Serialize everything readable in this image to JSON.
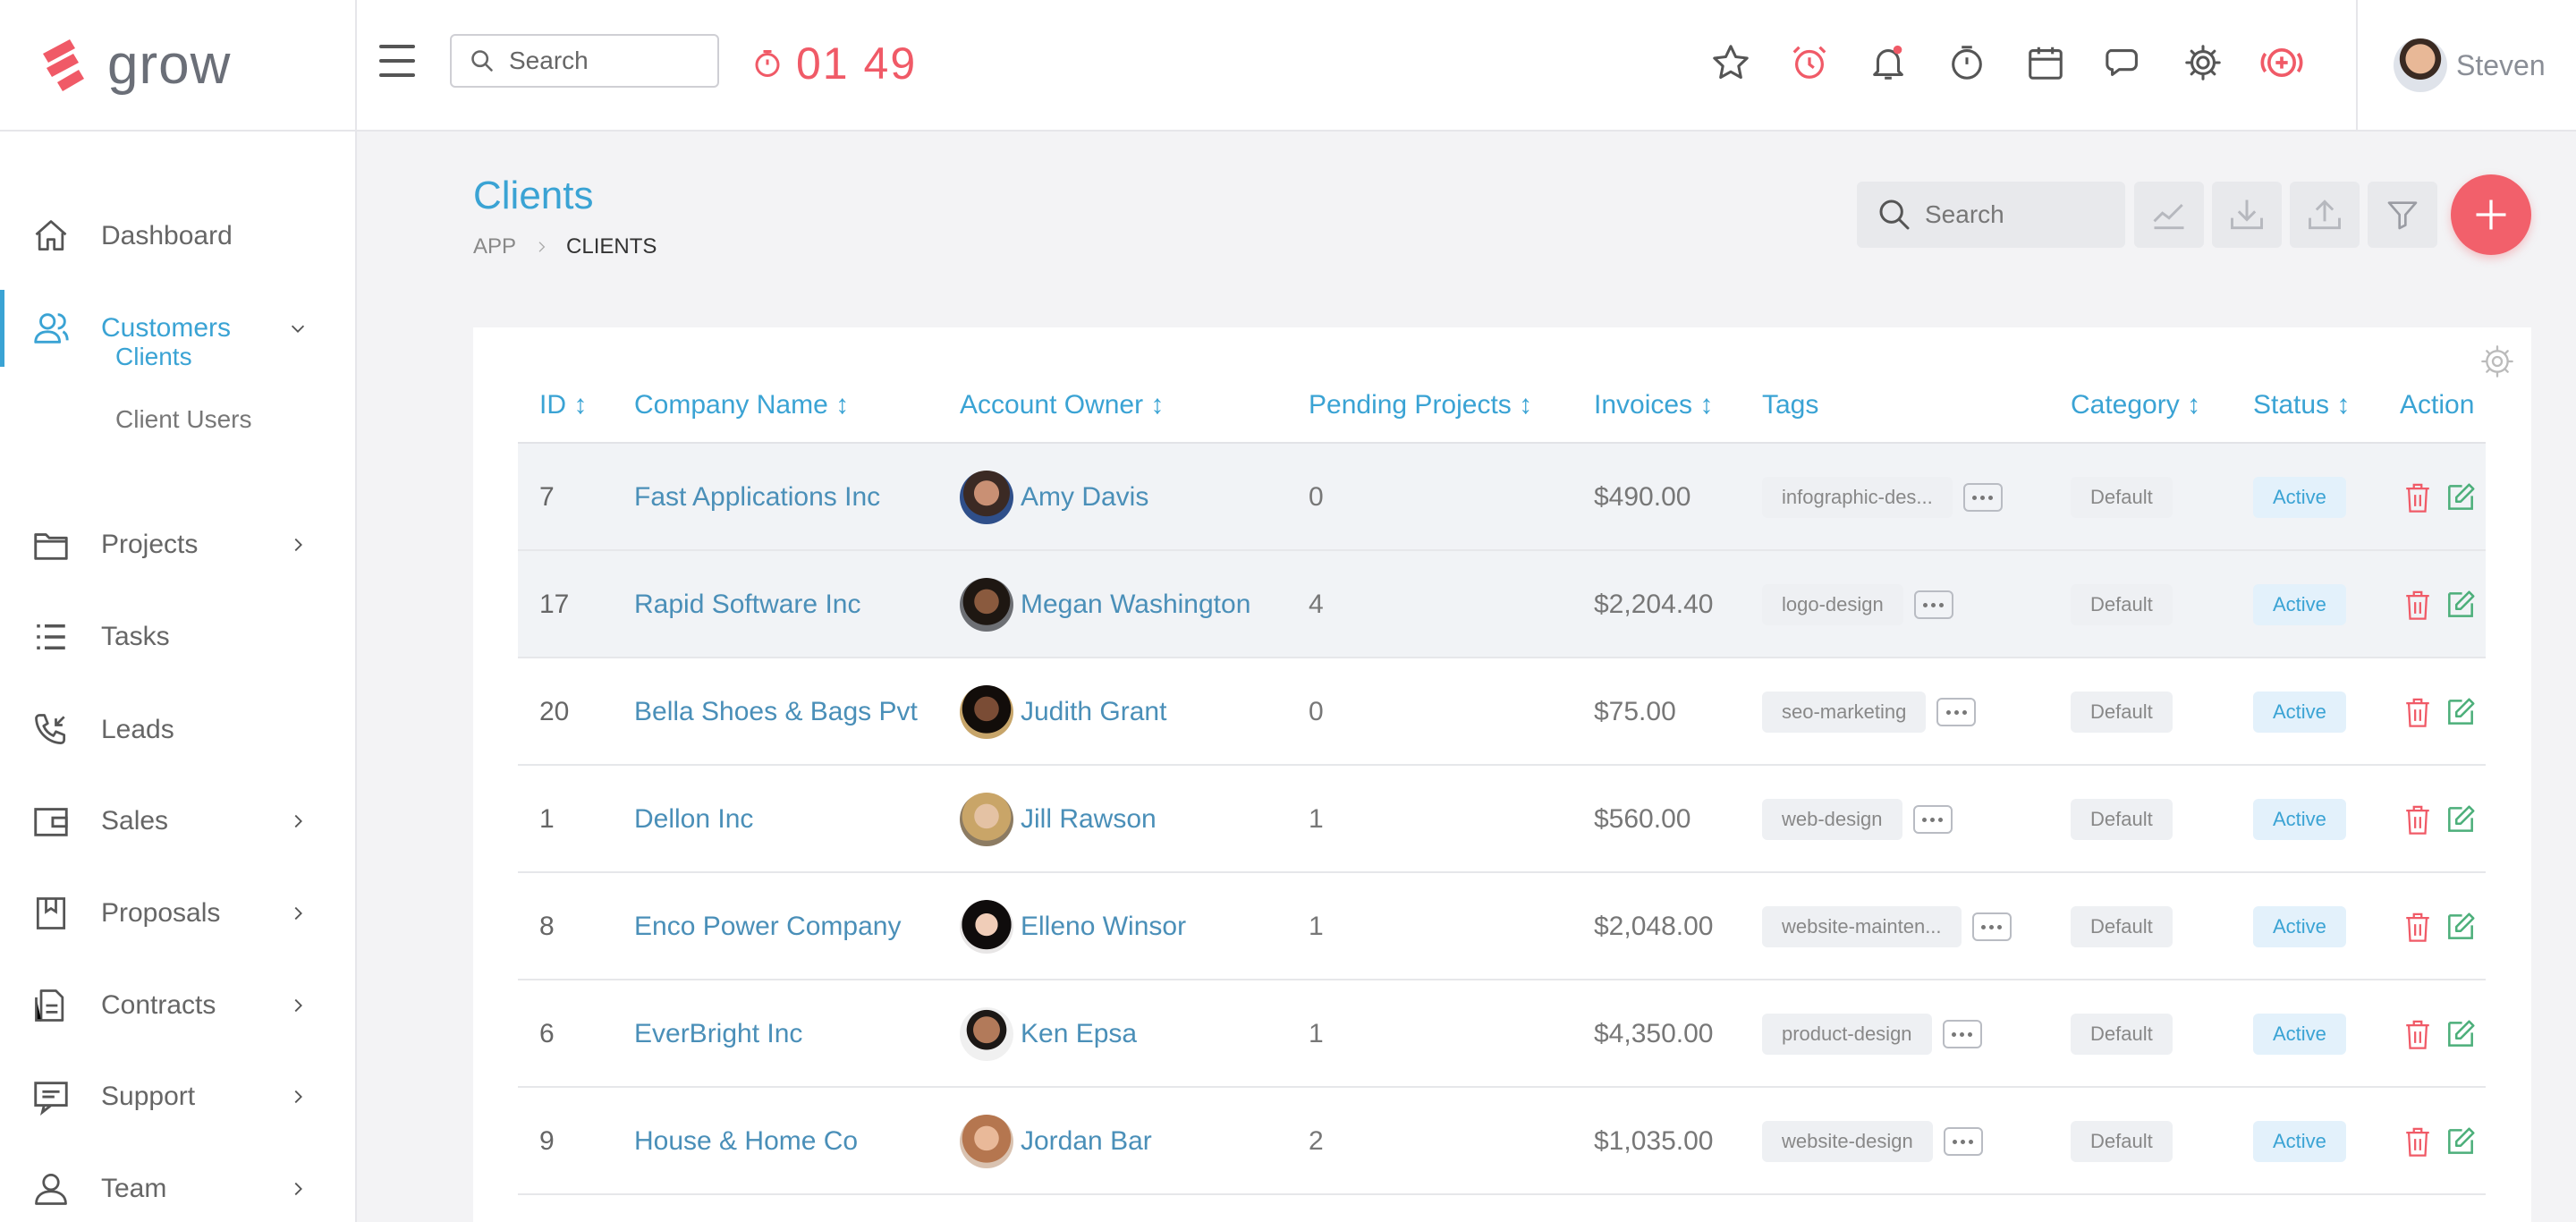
{
  "app": {
    "logo_text": "grow",
    "user_name": "Steven",
    "timer": "01 49"
  },
  "top_search": {
    "placeholder": "Search"
  },
  "colors": {
    "accent": "#3aa3d4",
    "danger": "#f05a67",
    "fab": "#f2606b",
    "edit": "#4caf7a"
  },
  "sidebar": {
    "items": [
      {
        "label": "Dashboard",
        "icon": "home-icon"
      },
      {
        "label": "Customers",
        "icon": "users-icon",
        "expanded": true
      },
      {
        "label": "Projects",
        "icon": "folder-icon"
      },
      {
        "label": "Tasks",
        "icon": "list-icon"
      },
      {
        "label": "Leads",
        "icon": "phone-icon"
      },
      {
        "label": "Sales",
        "icon": "wallet-icon"
      },
      {
        "label": "Proposals",
        "icon": "bookmark-icon"
      },
      {
        "label": "Contracts",
        "icon": "document-icon"
      },
      {
        "label": "Support",
        "icon": "chat-icon"
      },
      {
        "label": "Team",
        "icon": "user-icon"
      }
    ],
    "sub_items": [
      {
        "label": "Clients"
      },
      {
        "label": "Client Users"
      }
    ]
  },
  "page": {
    "title": "Clients",
    "breadcrumb": [
      "APP",
      "CLIENTS"
    ],
    "search_placeholder": "Search"
  },
  "table": {
    "columns": [
      "ID ↕",
      "Company Name ↕",
      "Account Owner ↕",
      "Pending Projects ↕",
      "Invoices ↕",
      "Tags",
      "Category ↕",
      "Status ↕",
      "Action"
    ],
    "rows": [
      {
        "id": "7",
        "company": "Fast Applications Inc",
        "owner": "Amy Davis",
        "pending": "0",
        "invoices": "$490.00",
        "tag": "infographic-des...",
        "category": "Default",
        "status": "Active"
      },
      {
        "id": "17",
        "company": "Rapid Software Inc",
        "owner": "Megan Washington",
        "pending": "4",
        "invoices": "$2,204.40",
        "tag": "logo-design",
        "category": "Default",
        "status": "Active"
      },
      {
        "id": "20",
        "company": "Bella Shoes & Bags Pvt",
        "owner": "Judith Grant",
        "pending": "0",
        "invoices": "$75.00",
        "tag": "seo-marketing",
        "category": "Default",
        "status": "Active"
      },
      {
        "id": "1",
        "company": "Dellon Inc",
        "owner": "Jill Rawson",
        "pending": "1",
        "invoices": "$560.00",
        "tag": "web-design",
        "category": "Default",
        "status": "Active"
      },
      {
        "id": "8",
        "company": "Enco Power Company",
        "owner": "Elleno Winsor",
        "pending": "1",
        "invoices": "$2,048.00",
        "tag": "website-mainten...",
        "category": "Default",
        "status": "Active"
      },
      {
        "id": "6",
        "company": "EverBright Inc",
        "owner": "Ken Epsa",
        "pending": "1",
        "invoices": "$4,350.00",
        "tag": "product-design",
        "category": "Default",
        "status": "Active"
      },
      {
        "id": "9",
        "company": "House & Home Co",
        "owner": "Jordan Bar",
        "pending": "2",
        "invoices": "$1,035.00",
        "tag": "website-design",
        "category": "Default",
        "status": "Active"
      }
    ]
  }
}
